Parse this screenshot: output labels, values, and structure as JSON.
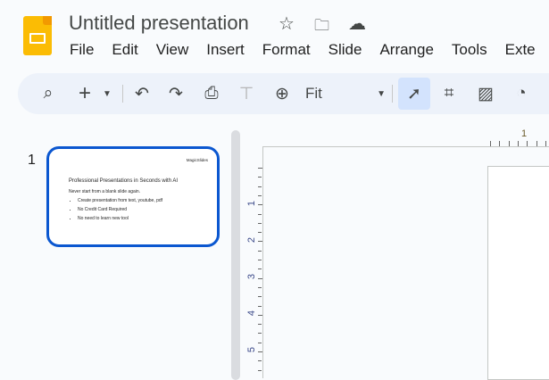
{
  "doc": {
    "title": "Untitled presentation"
  },
  "menu": [
    "File",
    "Edit",
    "View",
    "Insert",
    "Format",
    "Slide",
    "Arrange",
    "Tools",
    "Exte"
  ],
  "toolbar": {
    "zoom": "Fit"
  },
  "slides": [
    {
      "number": "1",
      "brand": "MagicSlides",
      "heading": "Professional Presentations in Seconds with AI",
      "subtitle": "Never start from a blank slide again.",
      "bullets": [
        "Create presentation from text, youtube, pdf",
        "No Credit Card Required",
        "No need to learn new tool"
      ]
    }
  ],
  "ruler": {
    "horizontal": [
      "1"
    ],
    "vertical": [
      "1",
      "2",
      "3",
      "4",
      "5"
    ]
  }
}
